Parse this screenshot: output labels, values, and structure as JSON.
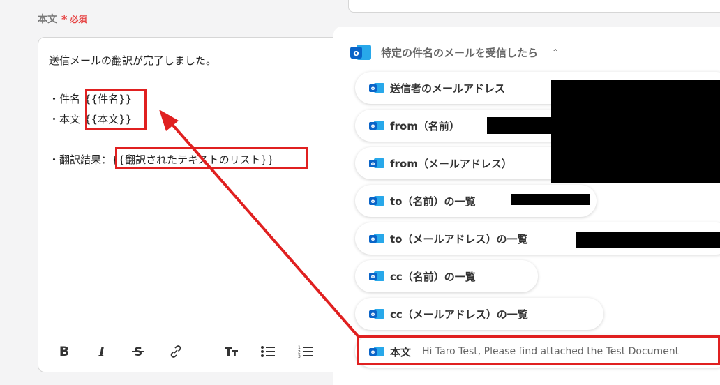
{
  "field": {
    "label": "本文",
    "asterisk": "*",
    "required": "必須"
  },
  "editor": {
    "line1": "送信メールの翻訳が完了しました。",
    "subject_prefix": "・件名",
    "subject_var": "{{件名}}",
    "body_prefix": "・本文",
    "body_var": "{{本文}}",
    "result_prefix": "・翻訳結果：",
    "result_var": "{{翻訳されたテキストのリスト}}",
    "toolbar": [
      "bold",
      "italic",
      "strikethrough",
      "link",
      "text-size",
      "bullet-list",
      "numbered-list"
    ]
  },
  "panel": {
    "section_title": "特定の件名のメールを受信したら",
    "section_chevron": "^",
    "items": [
      {
        "label": "送信者のメールアドレス",
        "preview": ""
      },
      {
        "label": "from（名前）",
        "preview": ""
      },
      {
        "label": "from（メールアドレス）",
        "preview": ""
      },
      {
        "label": "to（名前）の一覧",
        "preview": ""
      },
      {
        "label": "to（メールアドレス）の一覧",
        "preview": ""
      },
      {
        "label": "cc（名前）の一覧",
        "preview": ""
      },
      {
        "label": "cc（メールアドレス）の一覧",
        "preview": ""
      },
      {
        "label": "本文",
        "preview": "Hi Taro Test, Please find attached the Test Document"
      }
    ]
  },
  "colors": {
    "highlight": "#e02020",
    "outlook_dark": "#0a64c8",
    "outlook_light": "#28a8ea",
    "required": "#e64545"
  }
}
